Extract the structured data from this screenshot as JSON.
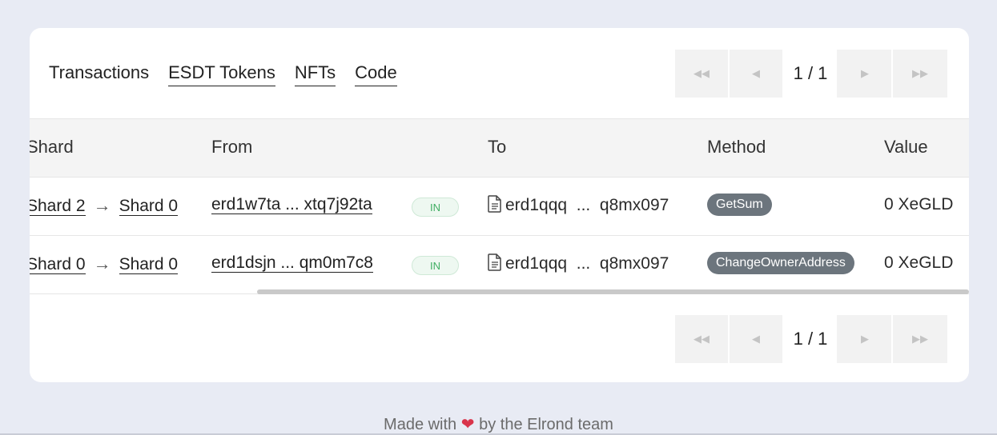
{
  "tabs": [
    {
      "label": "Transactions"
    },
    {
      "label": "ESDT Tokens"
    },
    {
      "label": "NFTs"
    },
    {
      "label": "Code"
    }
  ],
  "pagination": {
    "page_indicator": "1 / 1",
    "first_icon": "double-chevron-left-icon",
    "prev_icon": "chevron-left-icon",
    "next_icon": "chevron-right-icon",
    "last_icon": "double-chevron-right-icon"
  },
  "table": {
    "columns": [
      "Shard",
      "From",
      "To",
      "Method",
      "Value"
    ],
    "rows": [
      {
        "shard_from": "Shard 2",
        "shard_to": "Shard 0",
        "from": "erd1w7ta ... xtq7j92ta",
        "direction": "IN",
        "to": "erd1qqq  ...  q8mx097",
        "method": "GetSum",
        "value": "0 XeGLD"
      },
      {
        "shard_from": "Shard 0",
        "shard_to": "Shard 0",
        "from": "erd1dsjn ... qm0m7c8",
        "direction": "IN",
        "to": "erd1qqq  ...  q8mx097",
        "method": "ChangeOwnerAddress",
        "value": "0 XeGLD"
      }
    ]
  },
  "footer": {
    "prefix": "Made with",
    "suffix": "by the Elrond team",
    "heart_icon": "heart-icon"
  },
  "colors": {
    "background": "#e8ebf4",
    "card": "#ffffff",
    "badge_in": "#3fae62",
    "method_badge": "#6c757d",
    "heart": "#d9344b"
  }
}
